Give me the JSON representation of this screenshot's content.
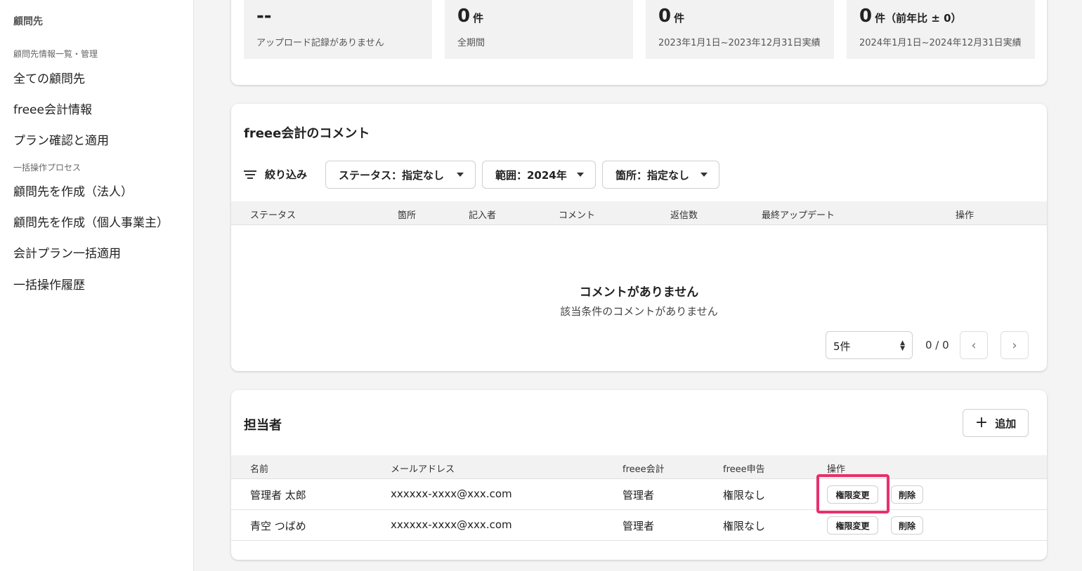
{
  "sidebar": {
    "title": "顧問先",
    "section1": "顧問先情報一覧・管理",
    "items1": [
      "全ての顧問先",
      "freee会計情報",
      "プラン確認と適用"
    ],
    "section2": "一括操作プロセス",
    "items2": [
      "顧問先を作成（法人）",
      "顧問先を作成（個人事業主）",
      "会計プラン一括適用",
      "一括操作履歴"
    ]
  },
  "stats": [
    {
      "value": "--",
      "unit": "",
      "desc": "アップロード記録がありません"
    },
    {
      "value": "0",
      "unit": "件",
      "desc": "全期間"
    },
    {
      "value": "0",
      "unit": "件",
      "desc": "2023年1月1日~2023年12月31日実績"
    },
    {
      "value": "0",
      "unit": "件（前年比 ± 0）",
      "desc": "2024年1月1日~2024年12月31日実績"
    }
  ],
  "comments": {
    "title": "freee会計のコメント",
    "filter_label": "絞り込み",
    "filters": [
      "ステータス：指定なし",
      "範囲：2024年",
      "箇所：指定なし"
    ],
    "columns": [
      "ステータス",
      "箇所",
      "記入者",
      "コメント",
      "返信数",
      "最終アップデート",
      "操作"
    ],
    "empty_title": "コメントがありません",
    "empty_sub": "該当条件のコメントがありません",
    "page_size": "5件",
    "page_info": "0 / 0",
    "prev_icon": "chevron-left-icon",
    "next_icon": "chevron-right-icon"
  },
  "persons": {
    "title": "担当者",
    "add_label": "追加",
    "columns": [
      "名前",
      "メールアドレス",
      "freee会計",
      "freee申告",
      "操作"
    ],
    "rows": [
      {
        "name": "管理者 太郎",
        "email": "xxxxxx-xxxx@xxx.com",
        "accounting": "管理者",
        "tax": "権限なし",
        "change": "権限変更",
        "delete": "削除"
      },
      {
        "name": "青空 つばめ",
        "email": "xxxxxx-xxxx@xxx.com",
        "accounting": "管理者",
        "tax": "権限なし",
        "change": "権限変更",
        "delete": "削除"
      }
    ],
    "highlight_color": "#e8306b"
  }
}
